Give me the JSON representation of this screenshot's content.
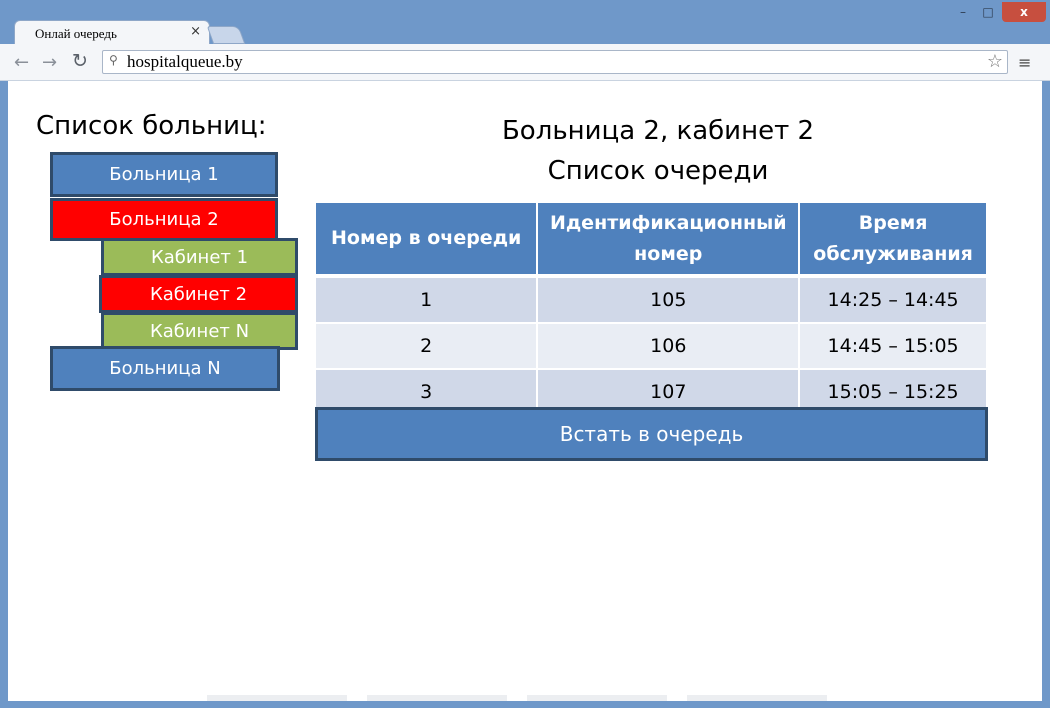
{
  "browser": {
    "tab_title": "Онлай очередь",
    "tab_close": "×",
    "url": "hospitalqueue.by",
    "window_controls": {
      "minimize": "–",
      "maximize": "□",
      "close": "x"
    },
    "nav": {
      "back": "←",
      "forward": "→",
      "reload": "↻",
      "menu": "≡",
      "star": "☆",
      "search_icon": "⚲"
    }
  },
  "sidebar": {
    "heading": "Список больниц:",
    "items": [
      {
        "label": "Больница 1",
        "state": "normal"
      },
      {
        "label": "Больница 2",
        "state": "selected"
      },
      {
        "label": "Кабинет 1",
        "state": "normal"
      },
      {
        "label": "Кабинет 2",
        "state": "selected"
      },
      {
        "label": "Кабинет N",
        "state": "normal"
      },
      {
        "label": "Больница N",
        "state": "normal"
      }
    ]
  },
  "main": {
    "title_line1": "Больница 2, кабинет 2",
    "title_line2": "Список очереди",
    "table": {
      "headers": [
        "Номер в очереди",
        "Идентификационный номер",
        "Время обслуживания"
      ],
      "rows": [
        [
          "1",
          "105",
          "14:25 – 14:45"
        ],
        [
          "2",
          "106",
          "14:45 – 15:05"
        ],
        [
          "3",
          "107",
          "15:05 – 15:25"
        ]
      ]
    },
    "join_button": "Встать в очередь"
  },
  "colors": {
    "primary": "#4f81bd",
    "selected": "#ff0000",
    "sub_item": "#9bbb59",
    "row_odd": "#d0d8e8",
    "row_even": "#e9edf4"
  }
}
